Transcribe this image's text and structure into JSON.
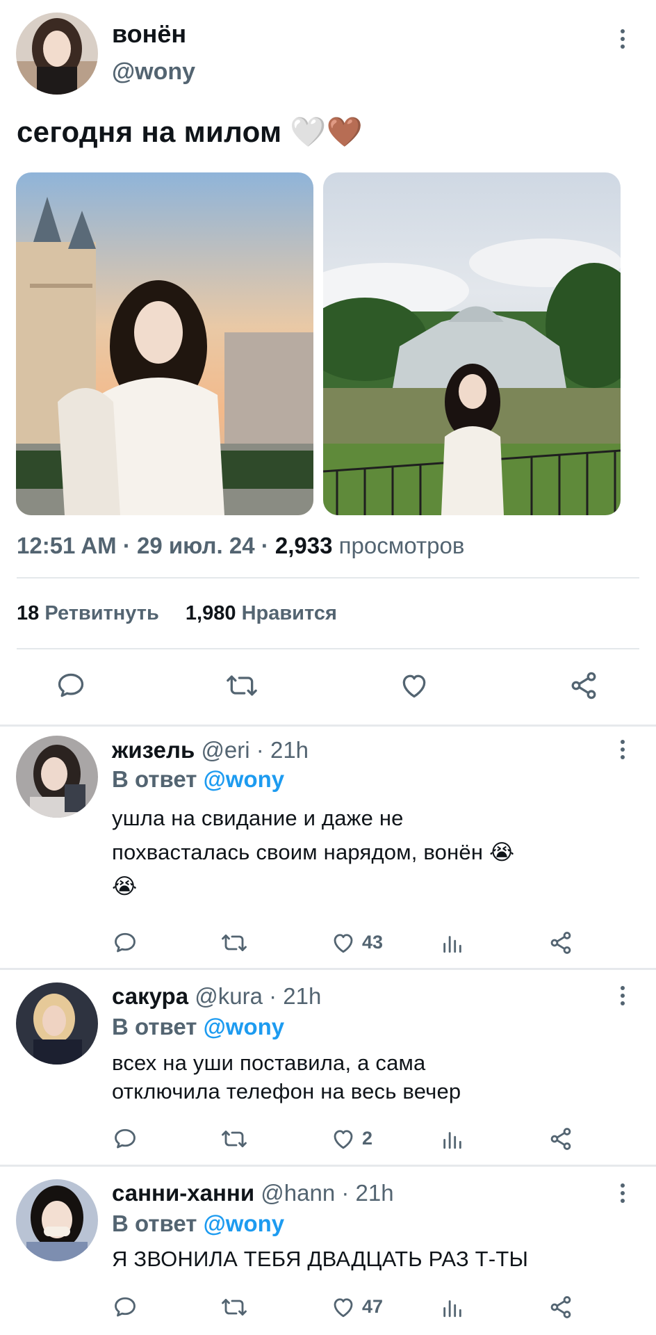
{
  "main_tweet": {
    "author_name": "вонён",
    "author_handle": "@wony",
    "text": "сегодня на милом 🤍🤎",
    "time": "12:51 AM",
    "date": "29 июл. 24",
    "views_count": "2,933",
    "views_label": "просмотров",
    "retweets_count": "18",
    "retweets_label": "Ретвитнуть",
    "likes_count": "1,980",
    "likes_label": "Нравится"
  },
  "replies": [
    {
      "name": "жизель",
      "handle": "@eri",
      "time": "21h",
      "reply_prefix": "В ответ",
      "reply_to": "@wony",
      "text_lines": [
        "ушла на свидание и даже не",
        "похвасталась своим нарядом, вонён 😭",
        "😭"
      ],
      "likes": "43"
    },
    {
      "name": "сакура",
      "handle": "@kura",
      "time": "21h",
      "reply_prefix": "В ответ",
      "reply_to": "@wony",
      "text_lines": [
        "всех на уши поставила, а сама",
        "отключила телефон на весь вечер"
      ],
      "likes": "2"
    },
    {
      "name": "санни-ханни",
      "handle": "@hann",
      "time": "21h",
      "reply_prefix": "В ответ",
      "reply_to": "@wony",
      "text_lines": [
        "Я ЗВОНИЛА ТЕБЯ ДВАДЦАТЬ РАЗ Т-ТЫ"
      ],
      "likes": "47"
    }
  ],
  "colors": {
    "text": "#0f1419",
    "secondary": "#536471",
    "accent": "#1d9bf0",
    "divider": "#e6e9ec"
  },
  "icons": {
    "reply": "comment-bubble-icon",
    "retweet": "retweet-icon",
    "like": "heart-icon",
    "share": "share-icon",
    "views": "bar-chart-icon",
    "more": "more-vertical-icon"
  }
}
